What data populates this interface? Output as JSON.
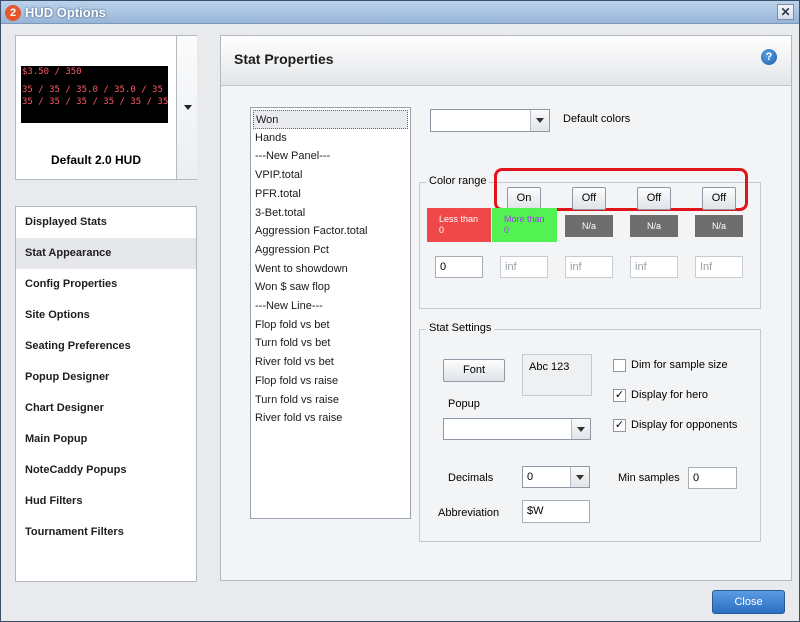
{
  "window": {
    "title": "HUD Options",
    "app_icon": "2",
    "close_glyph": "✕"
  },
  "hud_preview": {
    "title": "Default 2.0 HUD",
    "lines": [
      {
        "text": "$3.50 / 350",
        "color": "#ff5566"
      },
      {
        "text": "35 / 35 / 35.0 / 35.0 / 35 / 35 / 35",
        "color": "#ff5566"
      },
      {
        "text": "35 / 35 / 35 / 35 / 35 / 35",
        "color": "#ff5566"
      }
    ]
  },
  "nav": {
    "items": [
      {
        "label": "Displayed Stats"
      },
      {
        "label": "Stat Appearance",
        "active": true
      },
      {
        "label": "Config Properties"
      },
      {
        "label": "Site Options"
      },
      {
        "label": "Seating Preferences"
      },
      {
        "label": "Popup Designer"
      },
      {
        "label": "Chart Designer"
      },
      {
        "label": "Main Popup"
      },
      {
        "label": "NoteCaddy Popups"
      },
      {
        "label": "Hud Filters"
      },
      {
        "label": "Tournament Filters"
      }
    ]
  },
  "panel": {
    "title": "Stat Properties",
    "help_glyph": "?"
  },
  "stats": [
    "Won",
    "Hands",
    "---New Panel---",
    "VPIP.total",
    "PFR.total",
    "3-Bet.total",
    "Aggression Factor.total",
    "Aggression Pct",
    "Went to showdown",
    "Won $ saw flop",
    "---New Line---",
    "Flop fold vs bet",
    "Turn fold vs bet",
    "River fold vs bet",
    "Flop fold vs raise",
    "Turn fold vs raise",
    "River fold vs raise"
  ],
  "default_colors": {
    "label": "Default colors",
    "value": ""
  },
  "color_range": {
    "label": "Color range",
    "toggles": [
      "On",
      "Off",
      "Off",
      "Off"
    ],
    "swatches": [
      {
        "text1": "Less than",
        "text2": "0",
        "bg": "#f04848",
        "fg": "#ffffff"
      },
      {
        "text1": "More than",
        "text2": "0",
        "bg": "#52f252",
        "fg": "#a040e0"
      },
      {
        "text": "N/a"
      },
      {
        "text": "N/a"
      },
      {
        "text": "N/a"
      }
    ],
    "values": [
      "0",
      "inf",
      "inf",
      "inf",
      "Inf"
    ]
  },
  "stat_settings": {
    "label": "Stat Settings",
    "font_button": "Font",
    "font_preview": "Abc 123",
    "popup_label": "Popup",
    "popup_value": "",
    "checks": [
      {
        "label": "Dim for sample size",
        "checked": false,
        "glyph": ""
      },
      {
        "label": "Display for hero",
        "checked": true,
        "glyph": "✓"
      },
      {
        "label": "Display for opponents",
        "checked": true,
        "glyph": "✓"
      }
    ],
    "decimals_label": "Decimals",
    "decimals_value": "0",
    "min_samples_label": "Min samples",
    "min_samples_value": "0",
    "abbreviation_label": "Abbreviation",
    "abbreviation_value": "$W"
  },
  "footer": {
    "close_label": "Close"
  }
}
